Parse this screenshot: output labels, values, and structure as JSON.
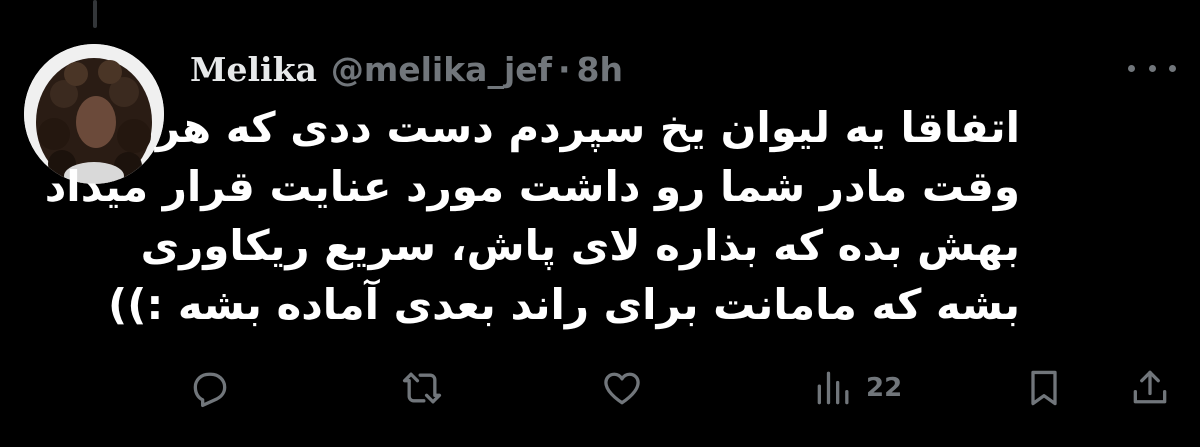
{
  "tweet": {
    "display_name": "Melika",
    "handle": "@melika_jef",
    "separator": "·",
    "time": "8h",
    "text_lines": [
      "اتفاقا یه لیوان یخ سپردم دست ددی که هر",
      "وقت مادر شما رو داشت مورد عنایت قرار میداد",
      "بهش بده که بذاره لای پاش، سریع ریکاوری",
      "بشه که مامانت برای راند بعدی آماده بشه :))"
    ]
  },
  "actions": {
    "views_count": "22"
  },
  "icons": {
    "more": "more-horizontal-icon",
    "reply": "reply-icon",
    "retweet": "retweet-icon",
    "like": "heart-icon",
    "views": "views-icon",
    "bookmark": "bookmark-icon",
    "share": "share-icon"
  },
  "colors": {
    "background": "#000000",
    "primary_text": "#e7e9ea",
    "secondary_text": "#71767b"
  }
}
